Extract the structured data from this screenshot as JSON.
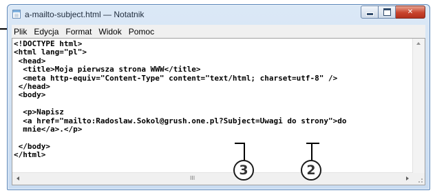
{
  "window": {
    "title": "a-mailto-subject.html — Notatnik",
    "icon": "notepad-icon",
    "controls": {
      "minimize": "minimize-icon",
      "maximize": "maximize-icon",
      "close": "✕"
    }
  },
  "menu": [
    "Plik",
    "Edycja",
    "Format",
    "Widok",
    "Pomoc"
  ],
  "editor": {
    "content": "<!DOCTYPE html>\n<html lang=\"pl\">\n <head>\n  <title>Moja pierwsza strona WWW</title>\n  <meta http-equiv=\"Content-Type\" content=\"text/html; charset=utf-8\" />\n </head>\n <body>\n\n  <p>Napisz\n  <a href=\"mailto:Radoslaw.Sokol@grush.one.pl?Subject=Uwagi do strony\">do\n  mnie</a>.</p>\n\n </body>\n</html>"
  },
  "scrollbar": {
    "grip": "III"
  },
  "callouts": [
    "3",
    "2"
  ]
}
